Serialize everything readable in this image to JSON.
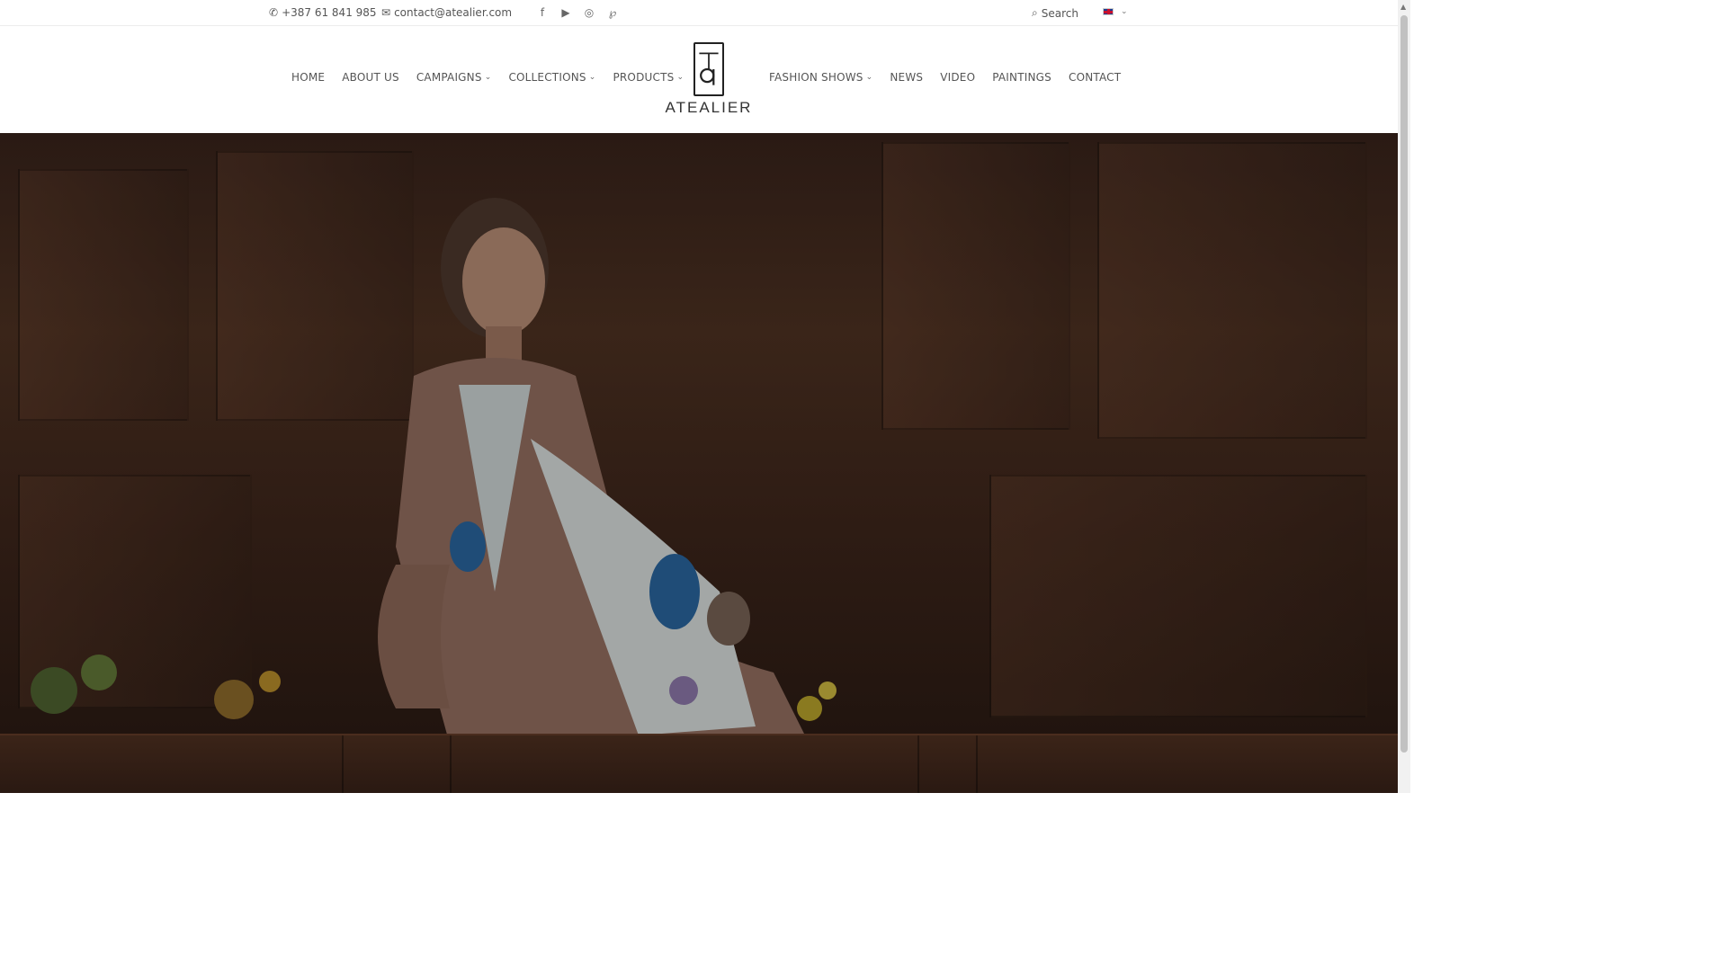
{
  "topbar": {
    "phone": "+387 61 841 985",
    "email": "contact@atealier.com",
    "social": [
      "facebook-icon",
      "youtube-icon",
      "instagram-icon",
      "pinterest-icon"
    ],
    "search_label": "Search",
    "language": "en"
  },
  "nav": {
    "left": [
      {
        "label": "HOME",
        "dropdown": false
      },
      {
        "label": "ABOUT US",
        "dropdown": false
      },
      {
        "label": "CAMPAIGNS",
        "dropdown": true
      },
      {
        "label": "COLLECTIONS",
        "dropdown": true
      },
      {
        "label": "PRODUCTS",
        "dropdown": true
      }
    ],
    "right": [
      {
        "label": "FASHION SHOWS",
        "dropdown": true
      },
      {
        "label": "NEWS",
        "dropdown": false
      },
      {
        "label": "VIDEO",
        "dropdown": false
      },
      {
        "label": "PAINTINGS",
        "dropdown": false
      },
      {
        "label": "CONTACT",
        "dropdown": false
      }
    ]
  },
  "logo": {
    "text": "ATEALIER"
  },
  "colors": {
    "text": "#555555",
    "hero_dark": "#2a1a14"
  }
}
